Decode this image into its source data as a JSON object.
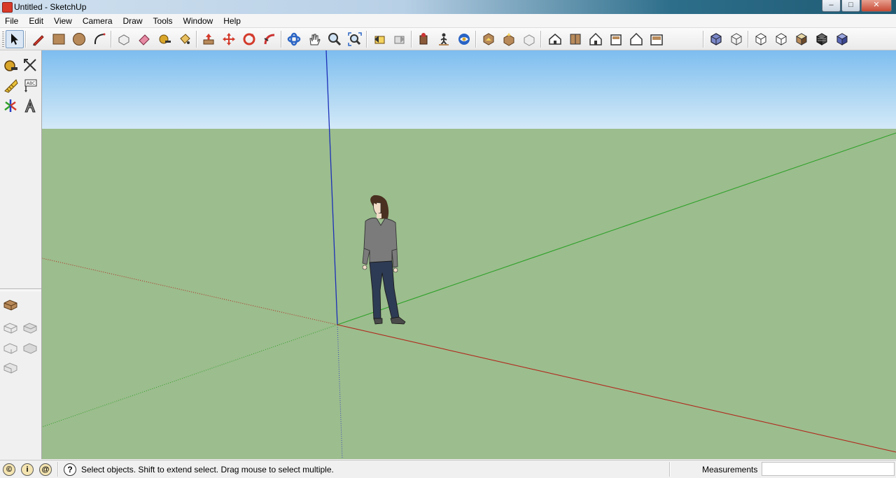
{
  "window": {
    "title": "Untitled - SketchUp",
    "controls": [
      "minimize",
      "maximize",
      "close"
    ]
  },
  "menu": [
    "File",
    "Edit",
    "View",
    "Camera",
    "Draw",
    "Tools",
    "Window",
    "Help"
  ],
  "toolbar": {
    "active_tool": "select",
    "groups": [
      [
        "select",
        "pencil-line",
        "rectangle",
        "circle",
        "arc"
      ],
      [
        "make-component",
        "eraser",
        "tape-measure",
        "paint-bucket"
      ],
      [
        "push-pull",
        "move",
        "rotate",
        "follow-me"
      ],
      [
        "orbit",
        "pan",
        "zoom",
        "zoom-extents"
      ],
      [
        "previous-view",
        "next-view"
      ],
      [
        "position-camera",
        "walk",
        "look-around"
      ],
      [
        "section-plane",
        "get-models",
        "share-model",
        "share-component"
      ],
      [
        "iso-view",
        "top-view",
        "front-view",
        "right-view",
        "back-view",
        "left-view"
      ],
      [
        "xray",
        "wireframe",
        "hidden-line",
        "shaded",
        "shaded-with-textures",
        "monochrome"
      ]
    ]
  },
  "left_palette": {
    "top": [
      "tape-measure",
      "dimension",
      "protractor",
      "text",
      "axes",
      "3d-text"
    ],
    "bottom": [
      "layers",
      "views-1",
      "views-2",
      "views-3",
      "views-4",
      "views-5"
    ]
  },
  "scene": {
    "sky_color": "#a9d4f2",
    "ground_color": "#9cbd8e",
    "axis_colors": {
      "red": "#b0291d",
      "green": "#2fa12a",
      "blue": "#1c2fb8"
    }
  },
  "status": {
    "message": "Select objects. Shift to extend select. Drag mouse to select multiple.",
    "measurements_label": "Measurements",
    "measurements_value": ""
  }
}
